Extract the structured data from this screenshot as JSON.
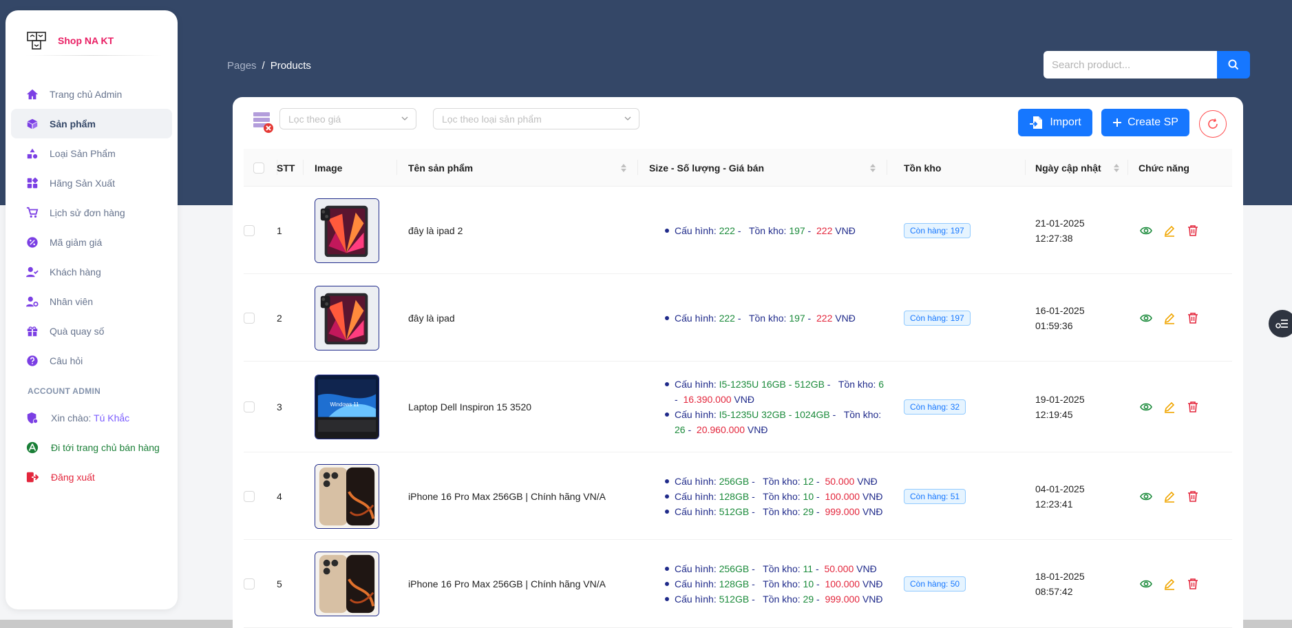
{
  "brand": {
    "name": "Shop NA KT"
  },
  "sidebar": {
    "items": [
      {
        "label": "Trang chủ Admin",
        "icon": "home-icon",
        "active": false
      },
      {
        "label": "Sản phẩm",
        "icon": "box-icon",
        "active": true
      },
      {
        "label": "Loại Sản Phẩm",
        "icon": "shapes-icon",
        "active": false
      },
      {
        "label": "Hãng Sản Xuất",
        "icon": "grid-icon",
        "active": false
      },
      {
        "label": "Lịch sử đơn hàng",
        "icon": "cart-icon",
        "active": false
      },
      {
        "label": "Mã giảm giá",
        "icon": "percent-icon",
        "active": false
      },
      {
        "label": "Khách hàng",
        "icon": "user-check-icon",
        "active": false
      },
      {
        "label": "Nhân viên",
        "icon": "user-gear-icon",
        "active": false
      },
      {
        "label": "Quà quay số",
        "icon": "gift-icon",
        "active": false
      },
      {
        "label": "Câu hỏi",
        "icon": "question-icon",
        "active": false
      }
    ],
    "account_title": "ACCOUNT ADMIN",
    "greeting_prefix": "Xin chào: ",
    "greeting_name": "Tú Khắc",
    "go_store": "Đi tới trang chủ bán hàng",
    "logout": "Đăng xuất"
  },
  "header": {
    "breadcrumb_root": "Pages",
    "breadcrumb_sep": "/",
    "breadcrumb_current": "Products",
    "search_placeholder": "Search product..."
  },
  "toolbar": {
    "price_filter_placeholder": "Lọc theo giá",
    "type_filter_placeholder": "Lọc theo loại sản phẩm",
    "import_label": "Import",
    "create_label": "Create SP"
  },
  "table": {
    "columns": {
      "stt": "STT",
      "image": "Image",
      "name": "Tên sản phẩm",
      "specs": "Size - Số lượng - Giá bán",
      "stock": "Tồn kho",
      "updated": "Ngày cập nhật",
      "actions": "Chức năng"
    },
    "spec_labels": {
      "config": "Cấu hình: ",
      "stock": "Tồn kho: ",
      "currency": "VNĐ"
    },
    "rows": [
      {
        "stt": "1",
        "name": "đây là ipad 2",
        "thumb": "ipad",
        "specs": [
          {
            "config": "222",
            "stock": "197",
            "price": "222"
          }
        ],
        "stock_tag": "Còn hàng: 197",
        "date": "21-01-2025",
        "time": "12:27:38"
      },
      {
        "stt": "2",
        "name": "đây là ipad",
        "thumb": "ipad",
        "specs": [
          {
            "config": "222",
            "stock": "197",
            "price": "222"
          }
        ],
        "stock_tag": "Còn hàng: 197",
        "date": "16-01-2025",
        "time": "01:59:36"
      },
      {
        "stt": "3",
        "name": "Laptop Dell Inspiron 15 3520",
        "thumb": "laptop",
        "specs": [
          {
            "config": "I5-1235U 16GB - 512GB",
            "stock": "6",
            "price": "16.390.000"
          },
          {
            "config": "I5-1235U 32GB - 1024GB",
            "stock": "26",
            "price": "20.960.000"
          }
        ],
        "stock_tag": "Còn hàng: 32",
        "date": "19-01-2025",
        "time": "12:19:45"
      },
      {
        "stt": "4",
        "name": "iPhone 16 Pro Max 256GB | Chính hãng VN/A",
        "thumb": "iphone",
        "specs": [
          {
            "config": "256GB",
            "stock": "12",
            "price": "50.000"
          },
          {
            "config": "128GB",
            "stock": "10",
            "price": "100.000"
          },
          {
            "config": "512GB",
            "stock": "29",
            "price": "999.000"
          }
        ],
        "stock_tag": "Còn hàng: 51",
        "date": "04-01-2025",
        "time": "12:23:41"
      },
      {
        "stt": "5",
        "name": "iPhone 16 Pro Max 256GB | Chính hãng VN/A",
        "thumb": "iphone",
        "specs": [
          {
            "config": "256GB",
            "stock": "11",
            "price": "50.000"
          },
          {
            "config": "128GB",
            "stock": "10",
            "price": "100.000"
          },
          {
            "config": "512GB",
            "stock": "29",
            "price": "999.000"
          }
        ],
        "stock_tag": "Còn hàng: 50",
        "date": "18-01-2025",
        "time": "08:57:42"
      }
    ]
  },
  "colors": {
    "header_bg": "#344767",
    "primary": "#1677ff",
    "brand": "#e91e63",
    "price_red": "#e3263c",
    "value_green": "#1a8a3a",
    "text_navy": "#1f2a8a"
  }
}
